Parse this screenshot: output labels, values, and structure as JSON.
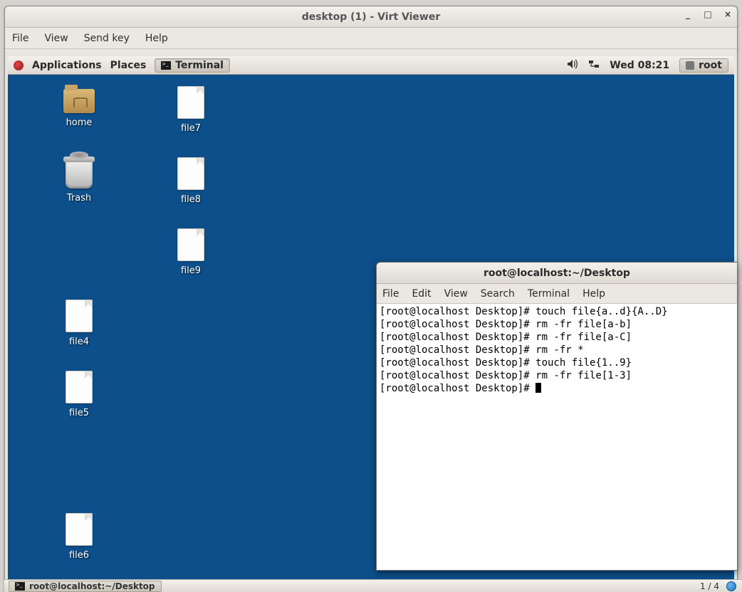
{
  "virt": {
    "title": "desktop (1) - Virt Viewer",
    "menu": {
      "file": "File",
      "view": "View",
      "sendkey": "Send key",
      "help": "Help"
    }
  },
  "panel": {
    "applications": "Applications",
    "places": "Places",
    "task_terminal": "Terminal",
    "clock": "Wed 08:21",
    "user": "root"
  },
  "desktop_icons": {
    "home": "home",
    "trash": "Trash",
    "file7": "file7",
    "file8": "file8",
    "file9": "file9",
    "file4": "file4",
    "file5": "file5",
    "file6": "file6"
  },
  "terminal": {
    "title": "root@localhost:~/Desktop",
    "menu": {
      "file": "File",
      "edit": "Edit",
      "view": "View",
      "search": "Search",
      "terminal": "Terminal",
      "help": "Help"
    },
    "lines": [
      "[root@localhost Desktop]# touch file{a..d}{A..D}",
      "[root@localhost Desktop]# rm -fr file[a-b]",
      "[root@localhost Desktop]# rm -fr file[a-C]",
      "[root@localhost Desktop]# rm -fr *",
      "[root@localhost Desktop]# touch file{1..9}",
      "[root@localhost Desktop]# rm -fr file[1-3]",
      "[root@localhost Desktop]# "
    ]
  },
  "host_taskbar": {
    "task": "root@localhost:~/Desktop",
    "workspace": "1 / 4"
  }
}
